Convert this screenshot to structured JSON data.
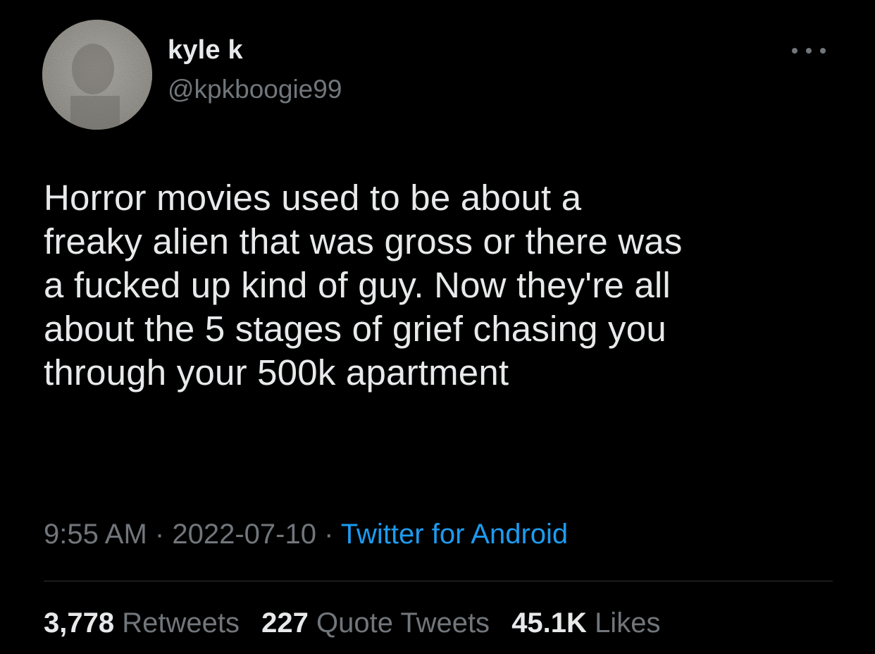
{
  "author": {
    "display_name": "kyle k",
    "handle": "@kpkboogie99"
  },
  "tweet": {
    "text": "Horror movies used to be about a\nfreaky alien that was gross or there was\na fucked up kind of guy. Now they're all\nabout the 5 stages of grief chasing you\nthrough your 500k apartment"
  },
  "meta": {
    "time": "9:55 AM",
    "separator": "·",
    "date": "2022-07-10",
    "source": "Twitter for Android"
  },
  "stats": {
    "retweets_count": "3,778",
    "retweets_label": "Retweets",
    "quote_tweets_count": "227",
    "quote_tweets_label": "Quote Tweets",
    "likes_count": "45.1K",
    "likes_label": "Likes"
  },
  "icons": {
    "more": "more-horizontal-icon"
  },
  "colors": {
    "background": "#000000",
    "text": "#e7e9ea",
    "secondary": "#71767b",
    "link": "#1d9bf0",
    "divider": "#2f3336"
  }
}
